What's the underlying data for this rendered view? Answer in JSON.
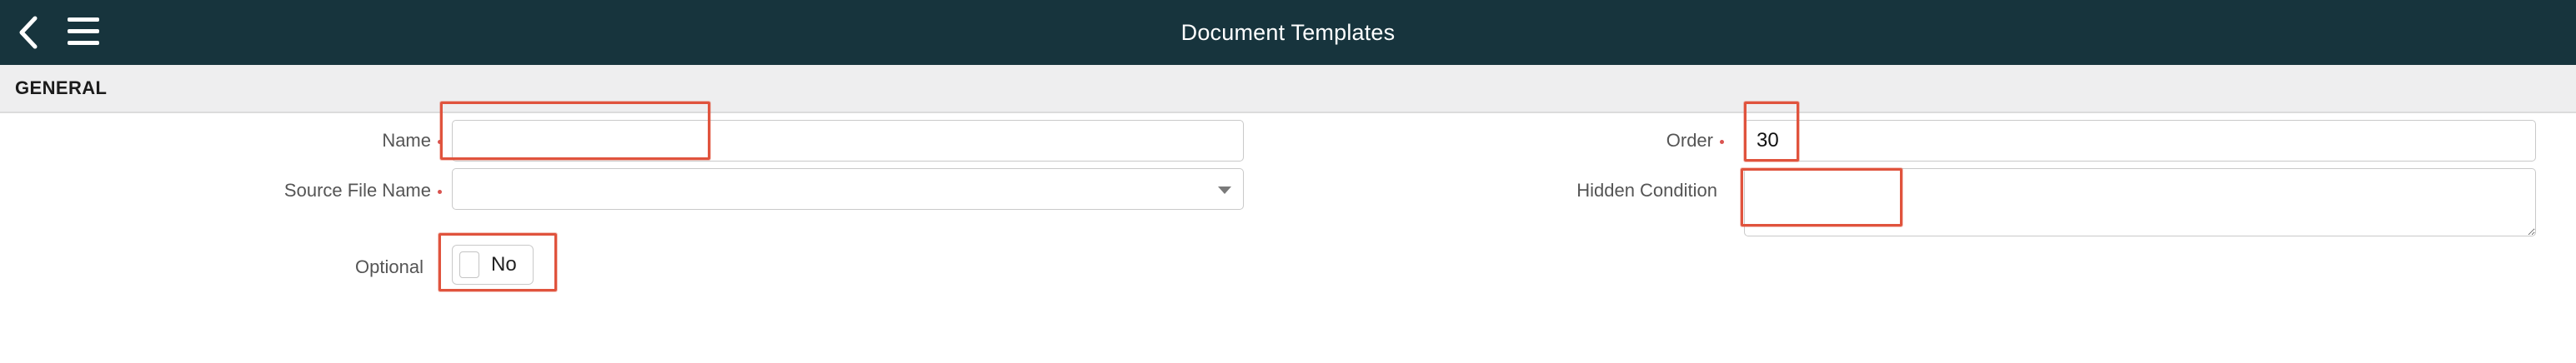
{
  "header": {
    "title": "Document Templates",
    "back_icon": "chevron-left-icon",
    "menu_icon": "hamburger-menu-icon"
  },
  "section": {
    "title": "GENERAL"
  },
  "fields": {
    "name": {
      "label": "Name",
      "value": "",
      "required": true
    },
    "source_file_name": {
      "label": "Source File Name",
      "value": "",
      "required": true
    },
    "optional": {
      "label": "Optional",
      "value": "No"
    },
    "order": {
      "label": "Order",
      "value": "30",
      "required": true
    },
    "hidden_condition": {
      "label": "Hidden Condition",
      "value": ""
    }
  },
  "colors": {
    "header_bg": "#17343d",
    "section_bg": "#eeeeef",
    "required_dot": "#d9534f",
    "highlight": "#e0533d"
  }
}
